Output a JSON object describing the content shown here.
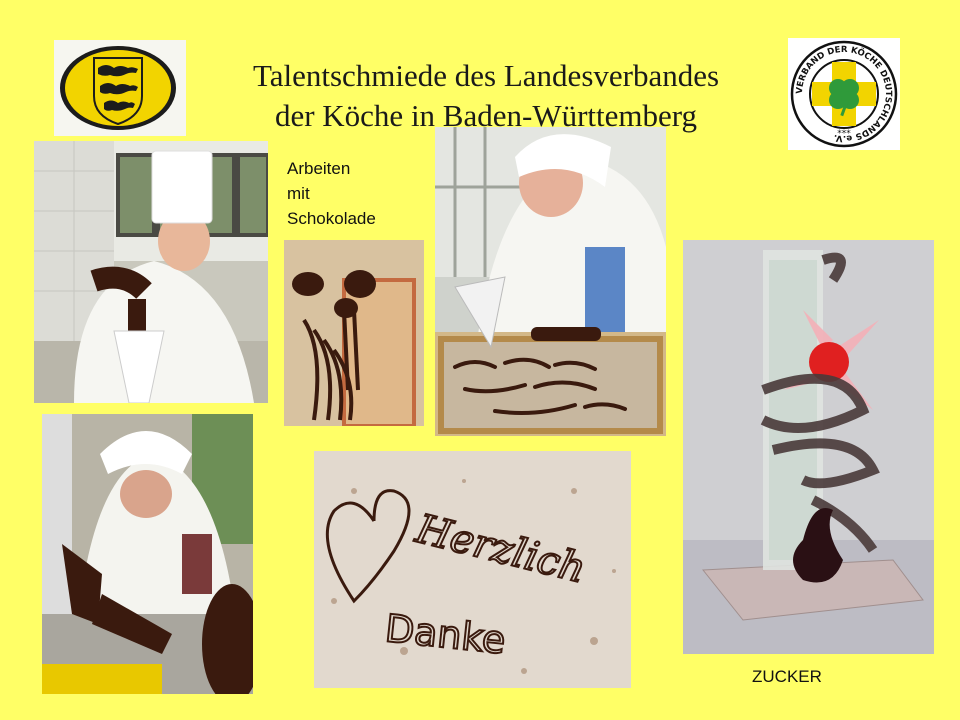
{
  "slide": {
    "title_line1": "Talentschmiede des Landesverbandes",
    "title_line2": "der Köche in Baden-Württemberg",
    "caption_chocolate": [
      "Arbeiten",
      "mit",
      "Schokolade"
    ],
    "caption_sugar": "ZUCKER",
    "logo_right_text": "VERBAND DER KÖCHE DEUTSCHLANDS e.V.",
    "logo_right_stars": "***",
    "plate_writing": [
      "Herzlich",
      "Danke"
    ]
  },
  "colors": {
    "background": "#ffff66",
    "chocolate": "#3a1a0e",
    "logo_green": "#2f9a3a",
    "logo_yellow": "#f2d400"
  }
}
